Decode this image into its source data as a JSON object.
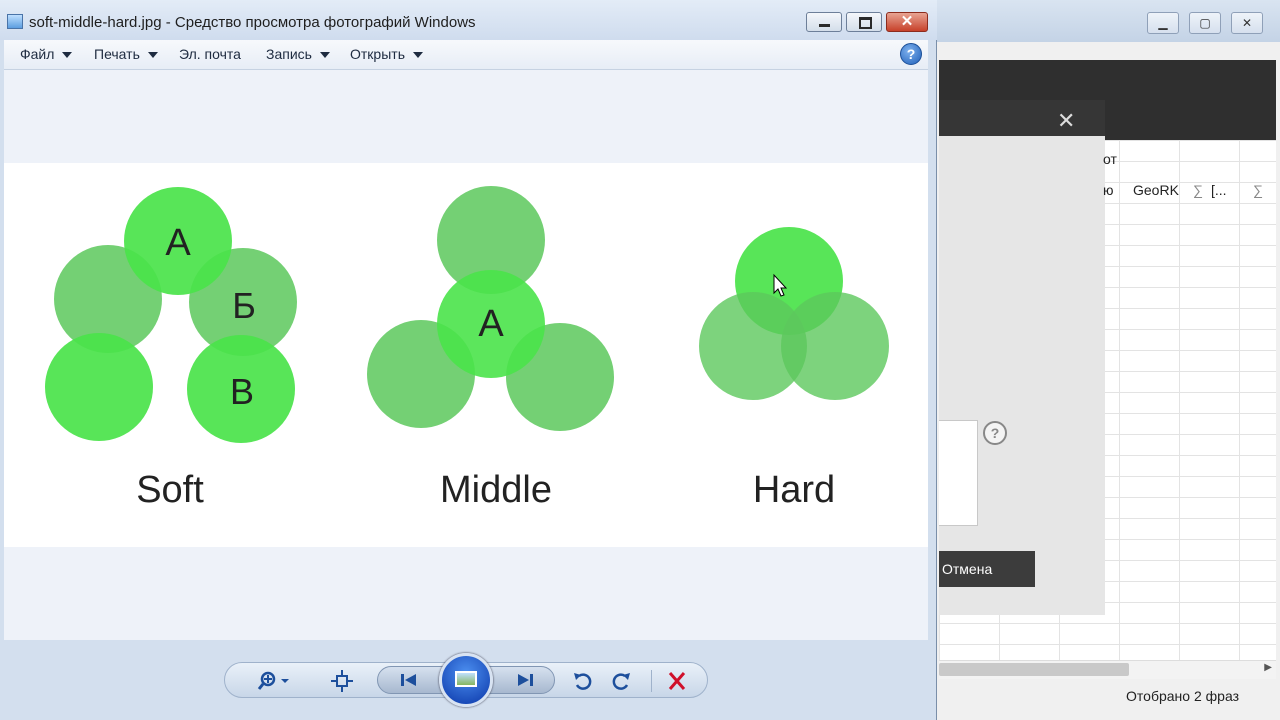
{
  "viewer": {
    "title": "soft-middle-hard.jpg - Средство просмотра фотографий Windows",
    "menu": [
      {
        "label": "Файл",
        "has_arrow": true
      },
      {
        "label": "Печать",
        "has_arrow": true
      },
      {
        "label": "Эл. почта",
        "has_arrow": false
      },
      {
        "label": "Запись",
        "has_arrow": true
      },
      {
        "label": "Открыть",
        "has_arrow": true
      }
    ],
    "help_symbol": "?",
    "close_symbol": "✕",
    "photo": {
      "captions": {
        "soft": "Soft",
        "middle": "Middle",
        "hard": "Hard"
      },
      "labels": {
        "a": "А",
        "b": "Б",
        "v": "В",
        "middle_a": "А"
      },
      "colors": {
        "bright": "#4ae34a",
        "muted": "#5cc85c"
      }
    },
    "toolbar": {
      "zoom": "zoom-icon",
      "fit": "fit-to-window-icon",
      "previous": "previous-icon",
      "slideshow": "slideshow-icon",
      "next": "next-icon",
      "rotate_ccw": "rotate-counterclockwise-icon",
      "rotate_cw": "rotate-clockwise-icon",
      "delete": "delete-icon",
      "delete_color": "#d0102a"
    }
  },
  "background_app": {
    "heading_tail": "от",
    "columns": [
      "ю",
      "GeoRK",
      "∑",
      "[...",
      "∑"
    ],
    "help_symbol": "?",
    "cancel_label": "Отмена",
    "status": "Отобрано 2 фраз"
  }
}
